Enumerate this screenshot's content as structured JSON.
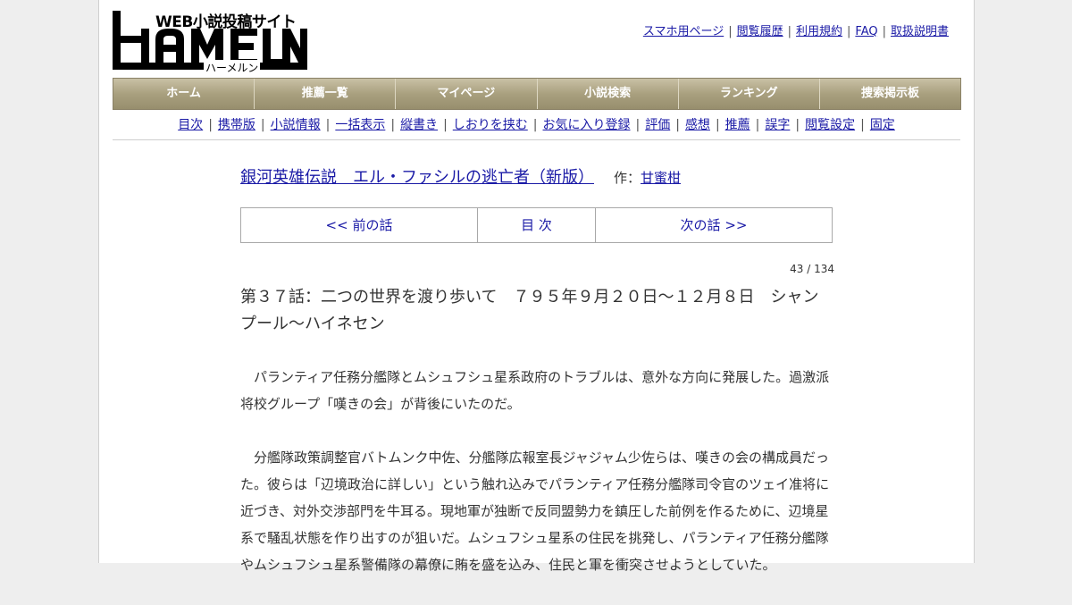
{
  "logo": {
    "tagline": "WEB小説投稿サイト",
    "wordmark": "HAMELN",
    "kana": "ハーメルン"
  },
  "toplinks": [
    "スマホ用ページ",
    "閲覧履歴",
    "利用規約",
    "FAQ",
    "取扱説明書"
  ],
  "mainnav": [
    "ホーム",
    "推薦一覧",
    "マイページ",
    "小説検索",
    "ランキング",
    "捜索掲示板"
  ],
  "subnav": [
    "目次",
    "携帯版",
    "小説情報",
    "一括表示",
    "縦書き",
    "しおりを挟む",
    "お気に入り登録",
    "評価",
    "感想",
    "推薦",
    "誤字",
    "閲覧設定",
    "固定"
  ],
  "novel": {
    "title": "銀河英雄伝説　エル・ファシルの逃亡者（新版）",
    "author_label": "作：",
    "author": "甘蜜柑"
  },
  "chapnav": {
    "prev": "<< 前の話",
    "toc": "目 次",
    "next": "次の話 >>"
  },
  "counter": "43 / 134",
  "chapter_title": "第３７話：二つの世界を渡り歩いて　７９５年９月２０日～１２月８日　シャンプール～ハイネセン",
  "paragraphs": [
    "パランティア任務分艦隊とムシュフシュ星系政府のトラブルは、意外な方向に発展した。過激派将校グループ「嘆きの会」が背後にいたのだ。",
    "分艦隊政策調整官バトムンク中佐、分艦隊広報室長ジャジャム少佐らは、嘆きの会の構成員だった。彼らは「辺境政治に詳しい」という触れ込みでパランティア任務分艦隊司令官のツェイ准将に近づき、対外交渉部門を牛耳る。現地軍が独断で反同盟勢力を鎮圧した前例を作るために、辺境星系で騒乱状態を作り出すのが狙いだ。ムシュフシュ星系の住民を挑発し、パランティア任務分艦隊やムシュフシュ星系警備隊の幕僚に賄を盛を込み、住民と軍を衝突させようとしていた。"
  ]
}
